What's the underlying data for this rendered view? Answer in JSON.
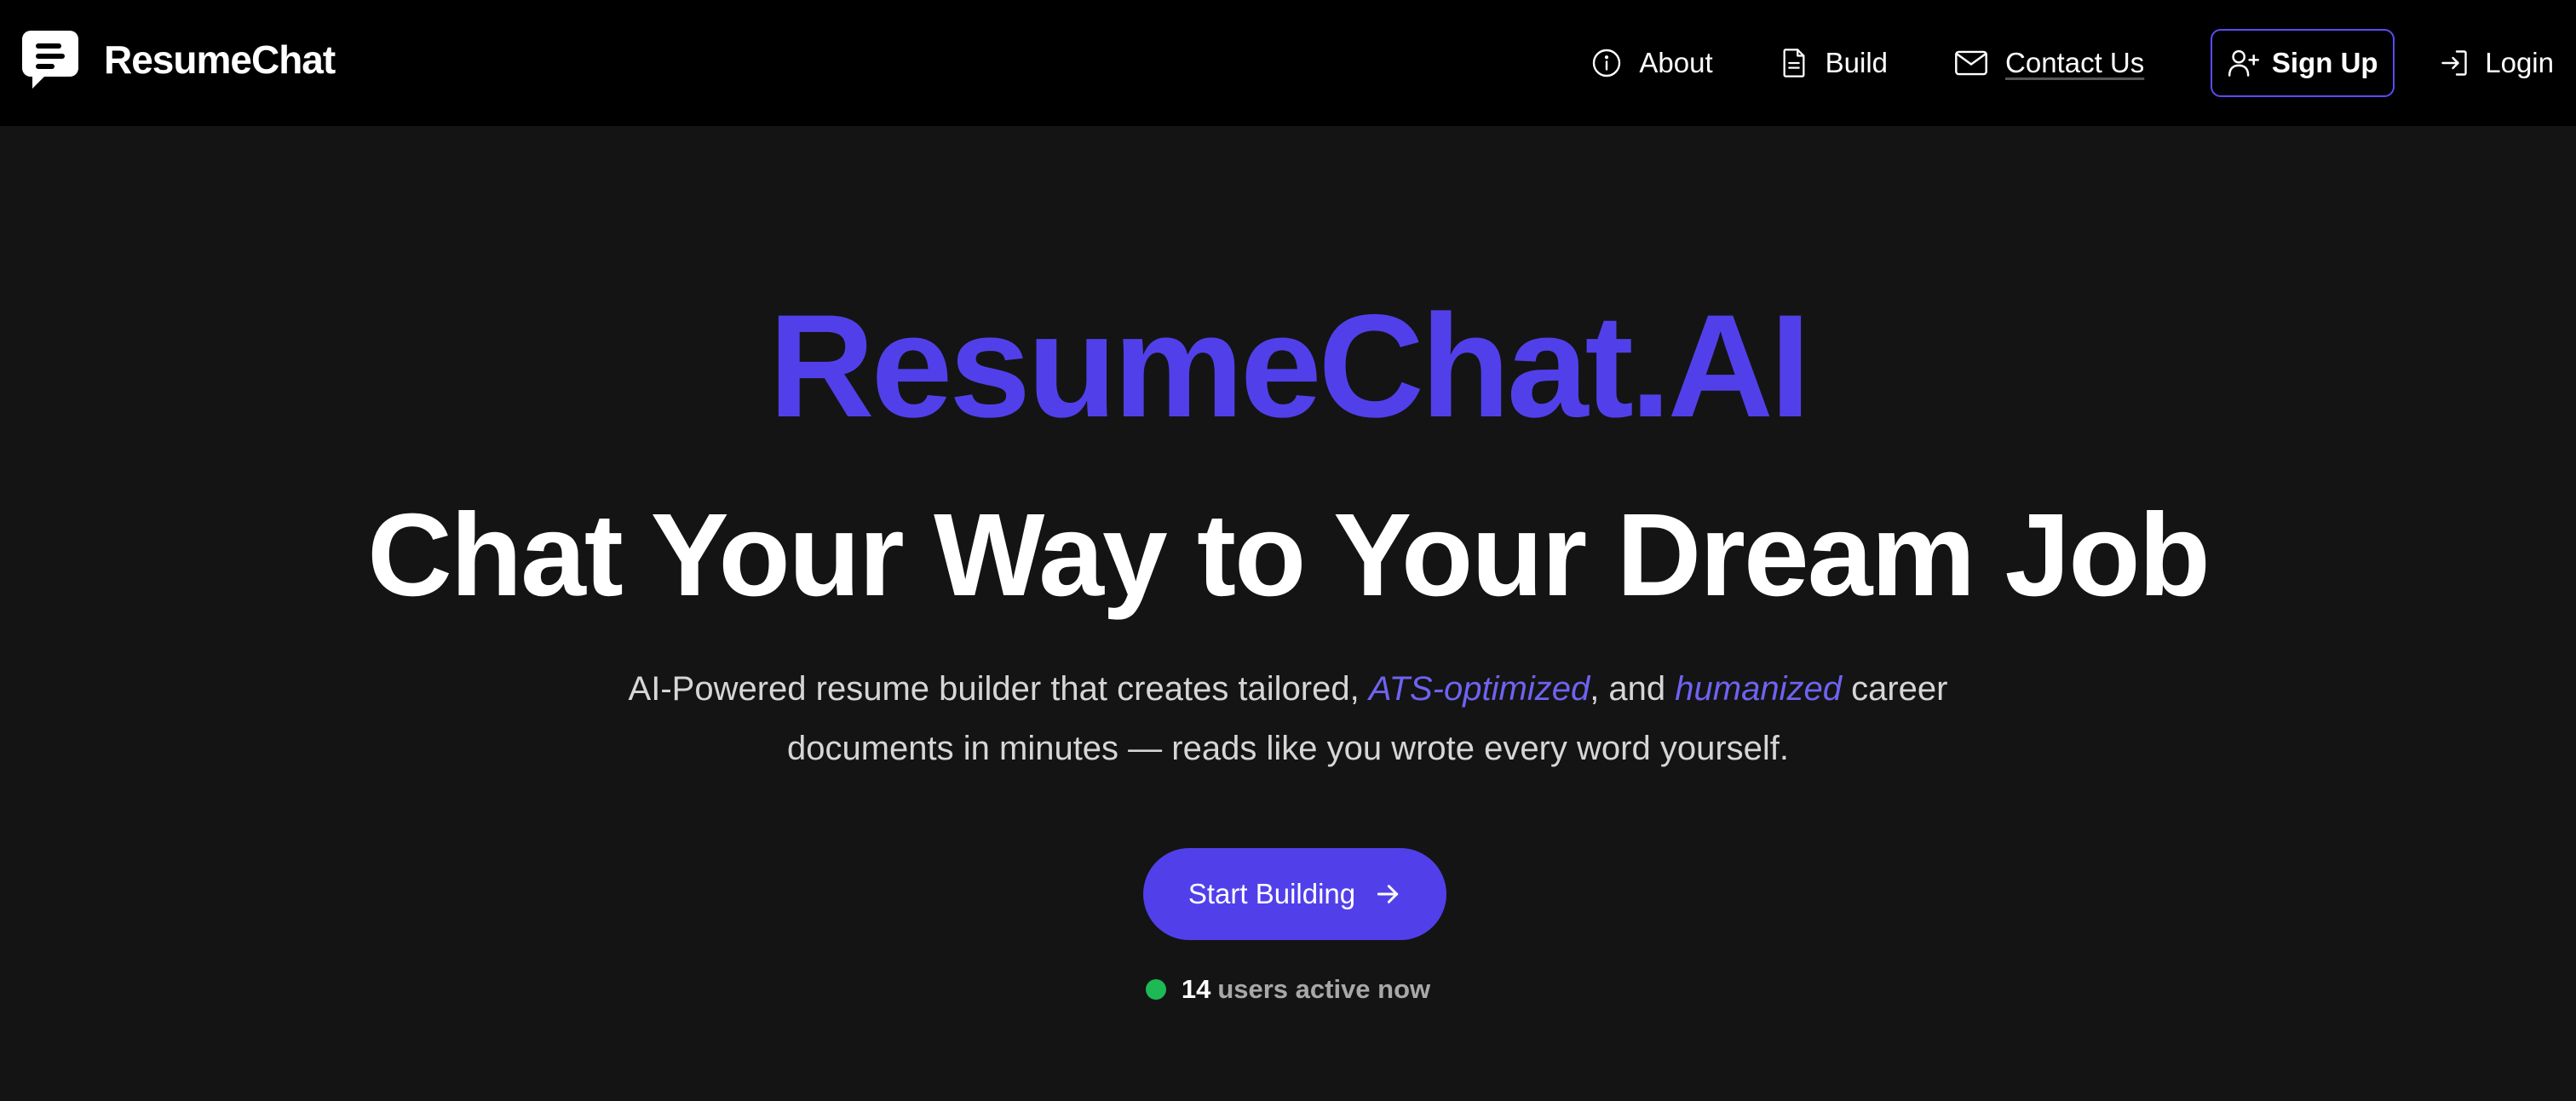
{
  "brand": {
    "name": "ResumeChat",
    "logo_icon": "chat-bubble-document-icon"
  },
  "nav": {
    "about": {
      "label": "About",
      "icon": "info-circle-icon"
    },
    "build": {
      "label": "Build",
      "icon": "document-icon"
    },
    "contact": {
      "label": "Contact Us",
      "icon": "mail-icon"
    },
    "signup": {
      "label": "Sign Up",
      "icon": "user-plus-icon"
    },
    "login": {
      "label": "Login",
      "icon": "login-arrow-icon"
    }
  },
  "hero": {
    "brand_title": "ResumeChat.AI",
    "headline": "Chat Your Way to Your Dream Job",
    "subtitle": {
      "part1": "AI-Powered resume builder that creates tailored, ",
      "highlight1": "ATS-optimized",
      "part2": ", and ",
      "highlight2": "humanized",
      "part3": " career documents in minutes — reads like you wrote every word yourself."
    },
    "cta_label": "Start Building",
    "cta_icon": "arrow-right-icon",
    "active_count": "14",
    "active_text": "users active now"
  },
  "colors": {
    "accent": "#5140ea",
    "nav_bg": "#000000",
    "page_bg": "#141414",
    "status_dot": "#1db954"
  }
}
